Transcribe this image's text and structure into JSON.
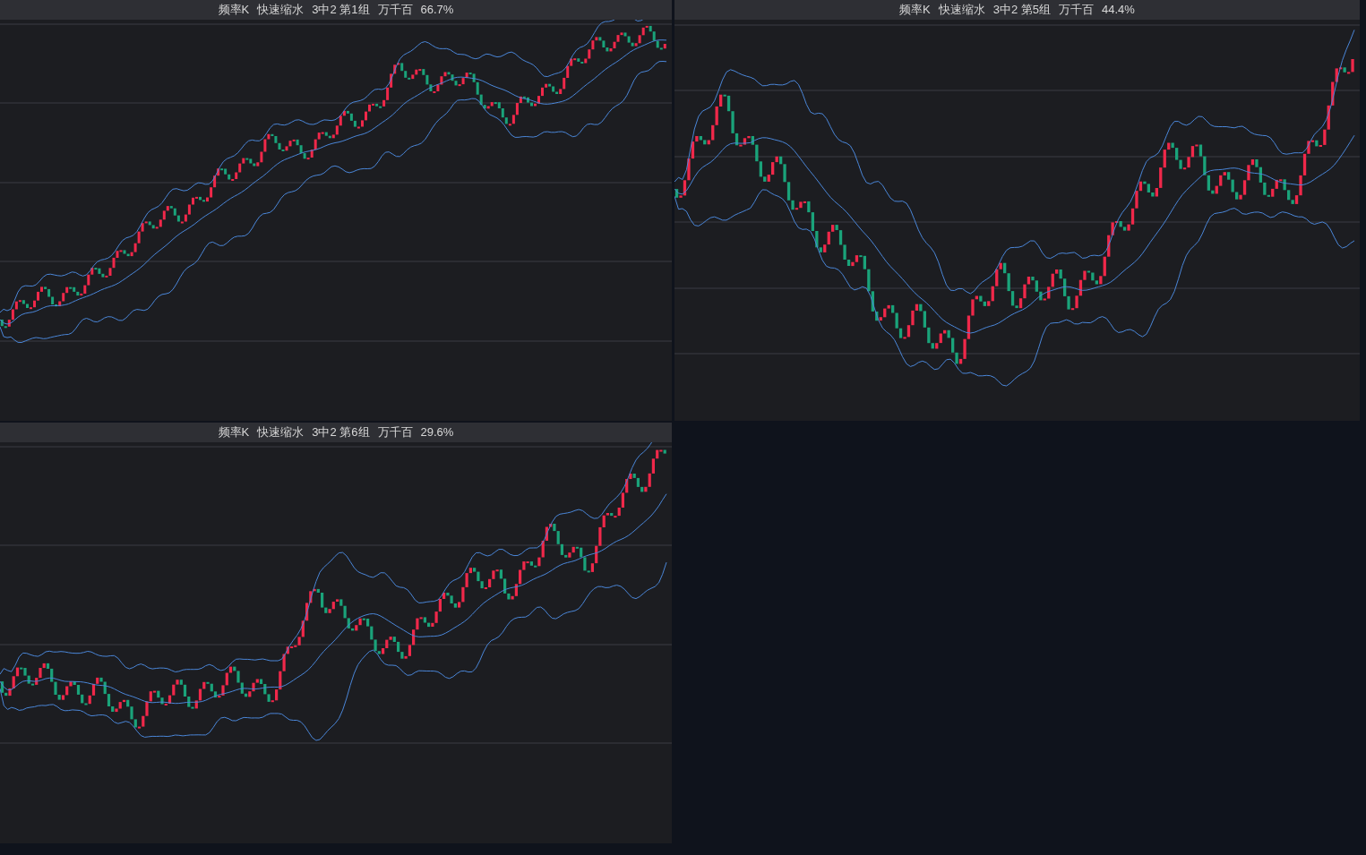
{
  "panels": [
    {
      "title_parts": [
        "频率K",
        "快速缩水",
        "3中2 第1组",
        "万千百",
        "66.7%"
      ]
    },
    {
      "title_parts": [
        "频率K",
        "快速缩水",
        "3中2 第5组",
        "万千百",
        "44.4%"
      ]
    },
    {
      "title_parts": [
        "频率K",
        "快速缩水",
        "3中2 第6组",
        "万千百",
        "29.6%"
      ]
    }
  ]
}
